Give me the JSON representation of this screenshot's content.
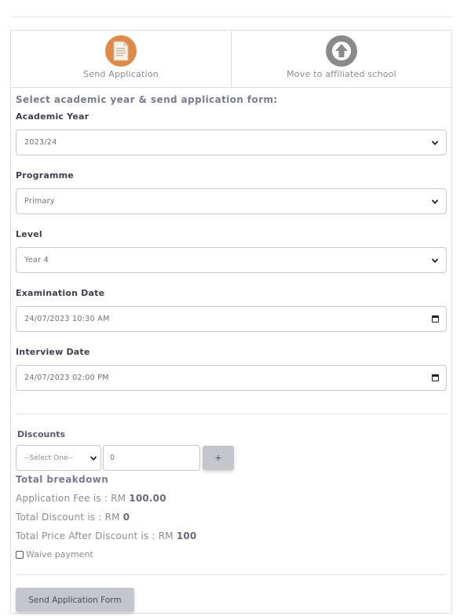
{
  "tabs": [
    {
      "label": "Send Application",
      "icon": "document-icon",
      "color": "#e08a4a"
    },
    {
      "label": "Move to affiliated school",
      "icon": "arrow-up-icon",
      "color": "#8a8a8a"
    }
  ],
  "form": {
    "heading": "Select academic year & send application form:",
    "academic_year": {
      "label": "Academic Year",
      "value": "2023/24"
    },
    "programme": {
      "label": "Programme",
      "value": "Primary"
    },
    "level": {
      "label": "Level",
      "value": "Year 4"
    },
    "examination_date": {
      "label": "Examination Date",
      "value": "24/07/2023 10:30 AM"
    },
    "interview_date": {
      "label": "Interview Date",
      "value": "24/07/2023 02:00 PM"
    }
  },
  "discounts": {
    "label": "Discounts",
    "select_value": "--Select One--",
    "amount_value": "0",
    "add_label": "+"
  },
  "breakdown": {
    "heading": "Total breakdown",
    "fee_prefix": "Application Fee is : RM ",
    "fee_value": "100.00",
    "discount_prefix": "Total Discount is : RM ",
    "discount_value": "0",
    "total_prefix": "Total Price After Discount is : RM ",
    "total_value": "100",
    "waive_label": "Waive payment",
    "waive_checked": false
  },
  "submit_label": "Send Application Form"
}
